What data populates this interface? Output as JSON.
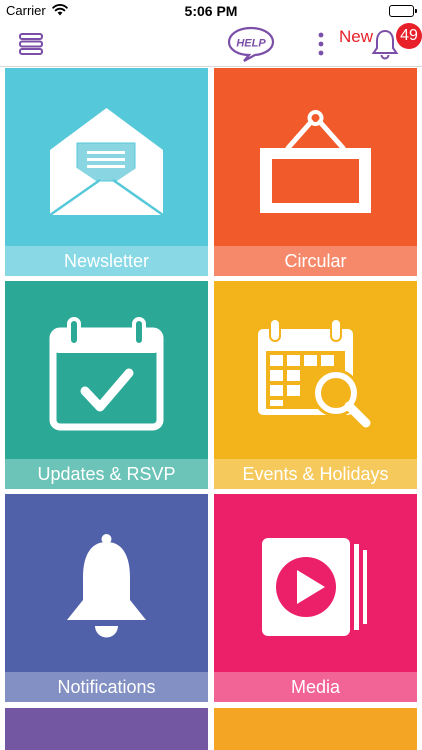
{
  "status_bar": {
    "carrier": "Carrier",
    "time": "5:06 PM"
  },
  "header": {
    "logo_text": "HELP",
    "new_label": "New",
    "notification_count": "49"
  },
  "tiles": [
    {
      "label": "Newsletter",
      "icon": "envelope-icon",
      "color": "#55c8d9"
    },
    {
      "label": "Circular",
      "icon": "hanging-sign-icon",
      "color": "#f15a2b"
    },
    {
      "label": "Updates & RSVP",
      "icon": "calendar-check-icon",
      "color": "#2ba896"
    },
    {
      "label": "Events & Holidays",
      "icon": "calendar-search-icon",
      "color": "#f3b31b"
    },
    {
      "label": "Notifications",
      "icon": "bell-icon",
      "color": "#5161a9"
    },
    {
      "label": "Media",
      "icon": "play-icon",
      "color": "#ec1f69"
    }
  ],
  "colors": {
    "accent_purple": "#7b4fa8",
    "badge_red": "#e8202a",
    "partial_tile_left": "#7357a3",
    "partial_tile_right": "#f5a524"
  }
}
